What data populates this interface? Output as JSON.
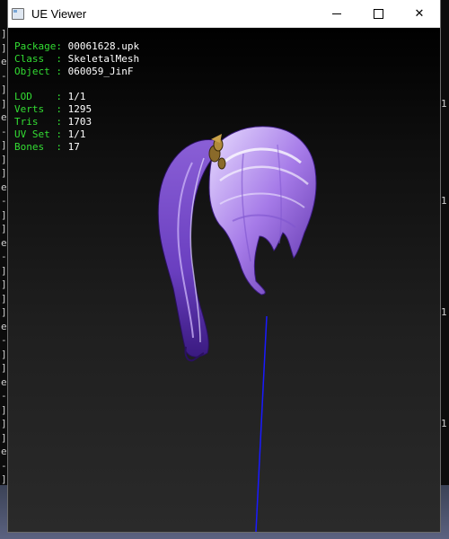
{
  "window": {
    "title": "UE Viewer",
    "close_glyph": "✕"
  },
  "background_console": {
    "left_glyphs": [
      "]",
      "]",
      "e",
      "-",
      "]",
      "]",
      "e",
      "-",
      "]",
      "]",
      "]",
      "e",
      "-",
      "]",
      "]",
      "e",
      "-",
      "]",
      "]",
      "]",
      "]",
      "e",
      "-",
      "]",
      "]",
      "e",
      "-",
      "]",
      "]",
      "]",
      "e",
      "-",
      "]"
    ],
    "right_glyphs": [
      "",
      "",
      "",
      "",
      "",
      "1",
      "",
      "",
      "",
      "",
      "",
      "",
      "1",
      "",
      "",
      "",
      "",
      "",
      "",
      "",
      "1",
      "",
      "",
      "",
      "",
      "",
      "",
      "",
      "1",
      "",
      "",
      "",
      ""
    ]
  },
  "info": {
    "package_label": "Package",
    "package_value": "00061628.upk",
    "class_label": "Class  ",
    "class_value": "SkeletalMesh",
    "object_label": "Object ",
    "object_value": "060059_JinF",
    "lod_label": "LOD    ",
    "lod_value": "1/1",
    "verts_label": "Verts  ",
    "verts_value": "1295",
    "tris_label": "Tris   ",
    "tris_value": "1703",
    "uvset_label": "UV Set ",
    "uvset_value": "1/1",
    "bones_label": "Bones  ",
    "bones_value": "17"
  },
  "colors": {
    "label_green": "#33dd33",
    "value_white": "#ffffff",
    "hair_purple": "#9b6fe0",
    "axis_blue": "#1a1aff"
  },
  "icons": [
    "app-window-icon",
    "minimize-icon",
    "maximize-icon",
    "close-icon"
  ]
}
